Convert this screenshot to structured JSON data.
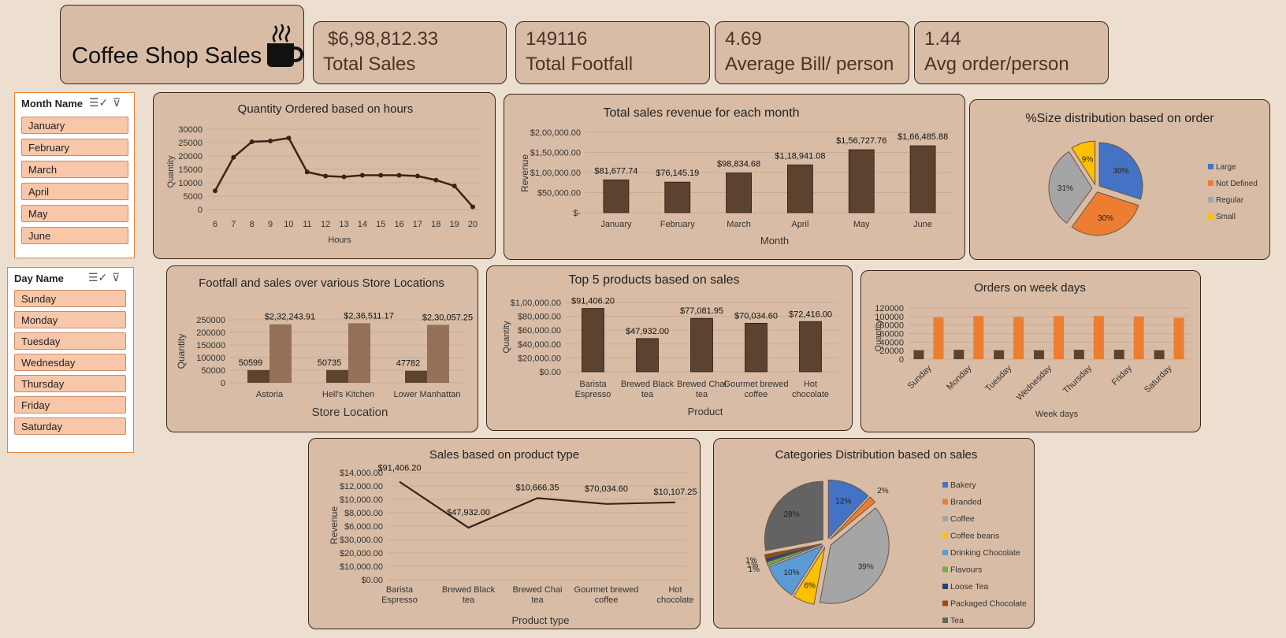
{
  "header": {
    "title": "Coffee Shop Sales",
    "icon": "coffee-cup-icon"
  },
  "kpis": [
    {
      "value": "$6,98,812.33",
      "label": "Total Sales"
    },
    {
      "value": "149116",
      "label": "Total Footfall"
    },
    {
      "value": "4.69",
      "label": "Average Bill/ person"
    },
    {
      "value": "1.44",
      "label": "Avg order/person"
    }
  ],
  "slicers": {
    "month": {
      "title": "Month Name",
      "items": [
        "January",
        "February",
        "March",
        "April",
        "May",
        "June"
      ]
    },
    "day": {
      "title": "Day Name",
      "items": [
        "Sunday",
        "Monday",
        "Tuesday",
        "Wednesday",
        "Thursday",
        "Friday",
        "Saturday"
      ]
    }
  },
  "colors": {
    "bar_dark": "#5c4330",
    "bar_light": "#957058",
    "orange": "#ed7d31",
    "blue": "#4472c4",
    "gray": "#a5a5a5",
    "yellow": "#ffc000"
  },
  "chart_data": [
    {
      "id": "hours",
      "type": "line",
      "title": "Quantity Ordered based on hours",
      "xlabel": "Hours",
      "ylabel": "Quantity",
      "x": [
        "6",
        "7",
        "8",
        "9",
        "10",
        "11",
        "12",
        "13",
        "14",
        "15",
        "16",
        "17",
        "18",
        "19",
        "20"
      ],
      "values": [
        7000,
        19500,
        25300,
        25600,
        26700,
        14000,
        12500,
        12200,
        12800,
        12800,
        12800,
        12500,
        11000,
        8800,
        1000
      ],
      "ylim": [
        0,
        30000
      ],
      "yticks": [
        "0",
        "5000",
        "10000",
        "15000",
        "20000",
        "25000",
        "30000"
      ]
    },
    {
      "id": "months",
      "type": "bar",
      "title": "Total sales revenue for each month",
      "xlabel": "Month",
      "ylabel": "Revenue",
      "categories": [
        "January",
        "February",
        "March",
        "April",
        "May",
        "June"
      ],
      "values": [
        81677.74,
        76145.19,
        98834.68,
        118941.08,
        156727.76,
        166485.88
      ],
      "labels": [
        "$81,677.74",
        "$76,145.19",
        "$98,834.68",
        "$1,18,941.08",
        "$1,56,727.76",
        "$1,66,485.88"
      ],
      "ylim": [
        0,
        200000
      ],
      "yticks": [
        "$-",
        "$50,000.00",
        "$1,00,000.00",
        "$1,50,000.00",
        "$2,00,000.00"
      ]
    },
    {
      "id": "size",
      "type": "pie",
      "title": "%Size distribution based on order",
      "categories": [
        "Large",
        "Not Defined",
        "Regular",
        "Small"
      ],
      "values": [
        30,
        30,
        31,
        9
      ],
      "labels": [
        "30%",
        "30%",
        "31%",
        "9%"
      ]
    },
    {
      "id": "stores",
      "type": "bar",
      "title": "Footfall and sales over various Store Locations",
      "xlabel": "Store Location",
      "ylabel": "Quantity",
      "categories": [
        "Astoria",
        "Hell's Kitchen",
        "Lower Manhattan"
      ],
      "series": [
        {
          "values": [
            50599,
            50735,
            47782
          ],
          "labels": [
            "50599",
            "50735",
            "47782"
          ]
        },
        {
          "values": [
            232243.91,
            236511.17,
            230057.25
          ],
          "labels": [
            "$2,32,243.91",
            "$2,36,511.17",
            "$2,30,057.25"
          ]
        }
      ],
      "ylim": [
        0,
        250000
      ],
      "yticks": [
        "0",
        "50000",
        "100000",
        "150000",
        "200000",
        "250000"
      ]
    },
    {
      "id": "top5",
      "type": "bar",
      "title": "Top 5 products based on sales",
      "xlabel": "Product",
      "ylabel": "Quantity",
      "categories": [
        "Barista Espresso",
        "Brewed Black tea",
        "Brewed Chai tea",
        "Gourmet brewed coffee",
        "Hot chocolate"
      ],
      "values": [
        91406.2,
        47932.0,
        77081.95,
        70034.6,
        72416.0
      ],
      "labels": [
        "$91,406.20",
        "$47,932.00",
        "$77,081.95",
        "$70,034.60",
        "$72,416.00"
      ],
      "ylim": [
        0,
        100000
      ],
      "yticks": [
        "$0.00",
        "$20,000.00",
        "$40,000.00",
        "$60,000.00",
        "$80,000.00",
        "$1,00,000.00"
      ]
    },
    {
      "id": "weekdays",
      "type": "bar",
      "title": "Orders on week days",
      "xlabel": "Week days",
      "ylabel": "Quantity",
      "categories": [
        "Sunday",
        "Monday",
        "Tuesday",
        "Wednesday",
        "Thursday",
        "Friday",
        "Saturday"
      ],
      "series": [
        {
          "values": [
            21000,
            22000,
            21000,
            21000,
            22000,
            22000,
            21000
          ]
        },
        {
          "values": [
            98000,
            101000,
            99000,
            101000,
            101000,
            100000,
            97000
          ]
        }
      ],
      "ylim": [
        0,
        120000
      ],
      "yticks": [
        "0",
        "20000",
        "40000",
        "60000",
        "80000",
        "100000",
        "120000"
      ]
    },
    {
      "id": "ptype",
      "type": "line",
      "title": "Sales based on product type",
      "xlabel": "Product type",
      "ylabel": "Revenue",
      "x": [
        "Barista Espresso",
        "Brewed Black tea",
        "Brewed Chai tea",
        "Gourmet brewed coffee",
        "Hot chocolate"
      ],
      "values": [
        12800,
        6800,
        10666.35,
        9900,
        10107.25
      ],
      "labels": [
        "$91,406.20",
        "$47,932.00",
        "$10,666.35",
        "$70,034.60",
        "$10,107.25"
      ],
      "ylim": [
        0,
        14000
      ],
      "yticks": [
        "$0.00",
        "$10,000.00",
        "$20,000.00",
        "$30,000.00",
        "$6,000.00",
        "$8,000.00",
        "$10,000.00",
        "$12,000.00",
        "$14,000.00"
      ]
    },
    {
      "id": "categories",
      "type": "pie",
      "title": "Categories Distribution based on sales",
      "categories": [
        "Bakery",
        "Branded",
        "Coffee",
        "Coffee beans",
        "Drinking Chocolate",
        "Flavours",
        "Loose Tea",
        "Packaged Chocolate",
        "Tea"
      ],
      "values": [
        12,
        2,
        39,
        6,
        10,
        1,
        1,
        1,
        28
      ],
      "labels": [
        "12%",
        "2%",
        "39%",
        "6%",
        "10%",
        "1%",
        "1%",
        "1%",
        "28%"
      ]
    }
  ]
}
